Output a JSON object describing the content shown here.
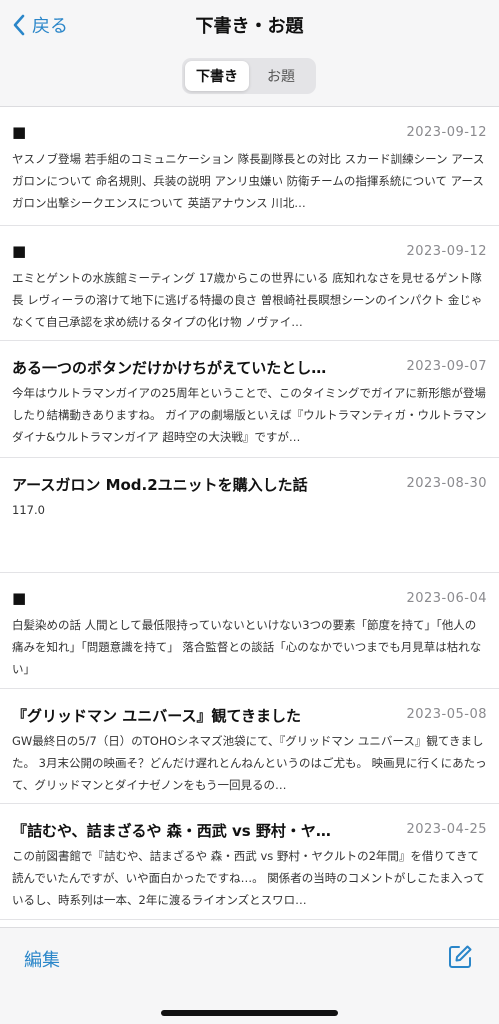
{
  "nav": {
    "back_label": "戻る",
    "title": "下書き・お題"
  },
  "segments": [
    "下書き",
    "お題"
  ],
  "selected_segment": "下書き",
  "items": [
    {
      "title": "■",
      "date": "2023-09-12",
      "body": "ヤスノブ登場 若手組のコミュニケーション 隊長副隊長との対比 スカード訓練シーン アースガロンについて 命名規則、兵装の説明 アンリ虫嫌い 防衛チームの指揮系統について アースガロン出撃シークエンスについて 英語アナウンス 川北…"
    },
    {
      "title": "■",
      "date": "2023-09-12",
      "body": "エミとゲントの水族館ミーティング 17歳からこの世界にいる 底知れなさを見せるゲント隊長 レヴィーラの溶けて地下に逃げる特撮の良さ 曽根崎社長瞑想シーンのインパクト 金じゃなくて自己承認を求め続けるタイプの化け物 ノヴァイ…"
    },
    {
      "title": "ある一つのボタンだけかけちがえていたとし…",
      "date": "2023-09-07",
      "body": "今年はウルトラマンガイアの25周年ということで、このタイミングでガイアに新形態が登場したり結構動きありますね。 ガイアの劇場版といえば『ウルトラマンティガ・ウルトラマンダイナ&ウルトラマンガイア 超時空の大決戦』ですが…"
    },
    {
      "title": "アースガロン Mod.2ユニットを購入した話",
      "date": "2023-08-30",
      "body": "117.0"
    },
    {
      "title": "■",
      "date": "2023-06-04",
      "body": "白髪染めの話 人間として最低限持っていないといけない3つの要素「節度を持て」「他人の痛みを知れ」「問題意識を持て」 落合監督との談話「心のなかでいつまでも月見草は枯れない」"
    },
    {
      "title": "『グリッドマン ユニバース』観てきました",
      "date": "2023-05-08",
      "body": "GW最終日の5/7（日）のTOHOシネマズ池袋にて、『グリッドマン ユニバース』観てきました。 3月末公開の映画そ？どんだけ遅れとんねんというのはご尤も。 映画見に行くにあたって、グリッドマンとダイナゼノンをもう一回見るの…"
    },
    {
      "title": "『詰むや、詰まざるや 森・西武 vs 野村・ヤ…",
      "date": "2023-04-25",
      "body": "この前図書館で『詰むや、詰まざるや 森・西武 vs 野村・ヤクルトの2年間』を借りてきて読んでいたんですが、いや面白かったですね…。 関係者の当時のコメントがしこたま入っているし、時系列は一本、2年に渡るライオンズとスワロ…"
    }
  ],
  "toolbar": {
    "edit_label": "編集",
    "compose_icon": "compose-icon"
  },
  "colors": {
    "accent": "#2a86c9",
    "date_text": "#8a8a8e",
    "bar_background": "#f6f6f7"
  }
}
